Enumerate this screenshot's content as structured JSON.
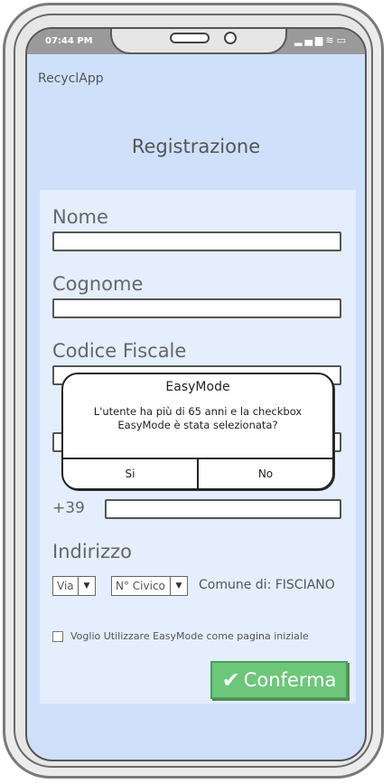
{
  "status_bar": {
    "time": "07:44 PM",
    "icons": [
      "signal-icon",
      "wifi-icon",
      "battery-icon"
    ]
  },
  "app": {
    "title": "RecyclApp"
  },
  "page": {
    "title": "Registrazione"
  },
  "form": {
    "nome_label": "Nome",
    "nome_value": "",
    "cognome_label": "Cognome",
    "cognome_value": "",
    "codice_fiscale_label": "Codice Fiscale",
    "codice_fiscale_value": "",
    "email_value": "",
    "phone_prefix": "+39",
    "phone_value": "",
    "indirizzo_label": "Indirizzo",
    "via_select": "Via",
    "civico_select": "N° Civico",
    "comune_text": "Comune di: FISCIANO",
    "easymode_checkbox_label": "Voglio Utilizzare EasyMode come pagina iniziale",
    "easymode_checked": false,
    "confirm_label": "Conferma"
  },
  "dialog": {
    "title": "EasyMode",
    "message": "L'utente ha più di 65 anni e la checkbox EasyMode è stata selezionata?",
    "yes_label": "Si",
    "no_label": "No"
  },
  "colors": {
    "screen_bg": "#cfe0fb",
    "panel_bg": "#e4eefd",
    "confirm_bg": "#6cc77a"
  }
}
